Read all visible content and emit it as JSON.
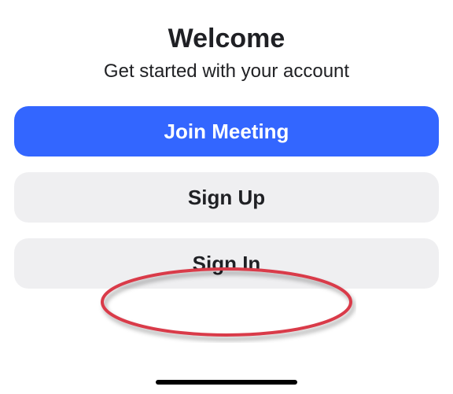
{
  "header": {
    "title": "Welcome",
    "subtitle": "Get started with your account"
  },
  "buttons": {
    "join_meeting": "Join Meeting",
    "sign_up": "Sign Up",
    "sign_in": "Sign In"
  },
  "annotation": {
    "target": "sign-in-button",
    "stroke_color": "#d93a4a"
  }
}
